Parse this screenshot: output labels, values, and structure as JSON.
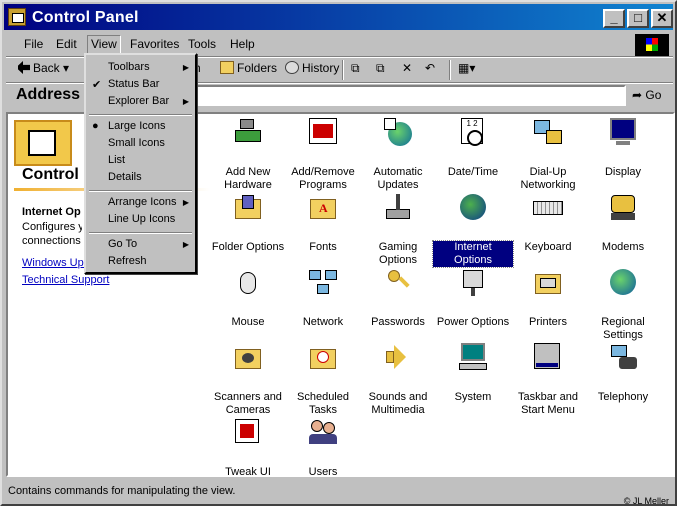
{
  "window": {
    "title": "Control Panel"
  },
  "menubar": {
    "items": [
      "File",
      "Edit",
      "View",
      "Favorites",
      "Tools",
      "Help"
    ],
    "active": "View"
  },
  "toolbar": {
    "back": "Back",
    "search_fragment": "ch",
    "folders": "Folders",
    "history": "History"
  },
  "address": {
    "label": "Address",
    "value": "",
    "go": "Go"
  },
  "view_menu": {
    "items": [
      {
        "label": "Toolbars",
        "submenu": true,
        "check": ""
      },
      {
        "label": "Status Bar",
        "submenu": false,
        "check": "✔"
      },
      {
        "label": "Explorer Bar",
        "submenu": true,
        "check": ""
      },
      {
        "sep": true
      },
      {
        "label": "Large Icons",
        "submenu": false,
        "check": "●"
      },
      {
        "label": "Small Icons",
        "submenu": false,
        "check": ""
      },
      {
        "label": "List",
        "submenu": false,
        "check": ""
      },
      {
        "label": "Details",
        "submenu": false,
        "check": ""
      },
      {
        "sep": true
      },
      {
        "label": "Arrange Icons",
        "submenu": true,
        "check": ""
      },
      {
        "label": "Line Up Icons",
        "submenu": false,
        "check": ""
      },
      {
        "sep": true
      },
      {
        "label": "Go To",
        "submenu": true,
        "check": ""
      },
      {
        "label": "Refresh",
        "submenu": false,
        "check": ""
      }
    ]
  },
  "left_pane": {
    "title": "Control",
    "subtitle": "Internet Op",
    "desc_lines": [
      "Configures yo",
      "connections s"
    ],
    "links": [
      "Windows Upd",
      "Technical Support"
    ]
  },
  "icons": [
    {
      "label": "Add New Hardware",
      "icon": "hardware-icon",
      "selected": false
    },
    {
      "label": "Add/Remove Programs",
      "icon": "programs-icon",
      "selected": false
    },
    {
      "label": "Automatic Updates",
      "icon": "globe-update-icon",
      "selected": false
    },
    {
      "label": "Date/Time",
      "icon": "calendar-clock-icon",
      "selected": false
    },
    {
      "label": "Dial-Up Networking",
      "icon": "dialup-icon",
      "selected": false
    },
    {
      "label": "Display",
      "icon": "monitor-icon",
      "selected": false
    },
    {
      "label": "Folder Options",
      "icon": "folder-options-icon",
      "selected": false
    },
    {
      "label": "Fonts",
      "icon": "fonts-folder-icon",
      "selected": false
    },
    {
      "label": "Gaming Options",
      "icon": "joystick-icon",
      "selected": false
    },
    {
      "label": "Internet Options",
      "icon": "internet-globe-icon",
      "selected": true
    },
    {
      "label": "Keyboard",
      "icon": "keyboard-icon",
      "selected": false
    },
    {
      "label": "Modems",
      "icon": "modem-icon",
      "selected": false
    },
    {
      "label": "Mouse",
      "icon": "mouse-icon",
      "selected": false
    },
    {
      "label": "Network",
      "icon": "network-icon",
      "selected": false
    },
    {
      "label": "Passwords",
      "icon": "keys-icon",
      "selected": false
    },
    {
      "label": "Power Options",
      "icon": "power-plug-icon",
      "selected": false
    },
    {
      "label": "Printers",
      "icon": "printer-folder-icon",
      "selected": false
    },
    {
      "label": "Regional Settings",
      "icon": "globe-icon",
      "selected": false
    },
    {
      "label": "Scanners and Cameras",
      "icon": "camera-icon",
      "selected": false
    },
    {
      "label": "Scheduled Tasks",
      "icon": "scheduled-folder-icon",
      "selected": false
    },
    {
      "label": "Sounds and Multimedia",
      "icon": "speaker-icon",
      "selected": false
    },
    {
      "label": "System",
      "icon": "computer-icon",
      "selected": false
    },
    {
      "label": "Taskbar and Start Menu",
      "icon": "taskbar-icon",
      "selected": false
    },
    {
      "label": "Telephony",
      "icon": "telephone-icon",
      "selected": false
    },
    {
      "label": "Tweak UI",
      "icon": "tweak-icon",
      "selected": false
    },
    {
      "label": "Users",
      "icon": "users-icon",
      "selected": false
    }
  ],
  "status": {
    "text": "Contains commands for manipulating the view.",
    "credit": "© JL Meller"
  }
}
